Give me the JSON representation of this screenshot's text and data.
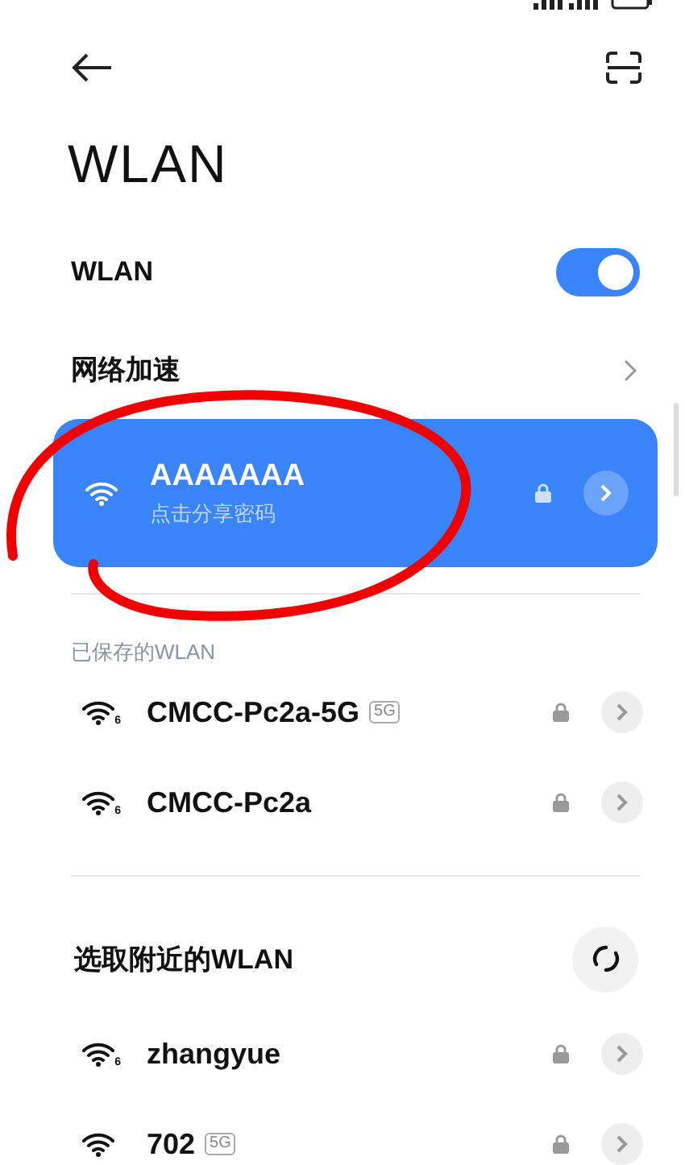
{
  "header": {
    "title": "WLAN"
  },
  "wlan_toggle": {
    "label": "WLAN",
    "on": true
  },
  "network_boost": {
    "label": "网络加速"
  },
  "connected": {
    "name": "AAAAAAA",
    "subtitle": "点击分享密码",
    "secured": true
  },
  "saved": {
    "heading": "已保存的WLAN",
    "networks": [
      {
        "name": "CMCC-Pc2a-5G",
        "band": "5G",
        "wifi_badge": "6",
        "secured": true
      },
      {
        "name": "CMCC-Pc2a",
        "wifi_badge": "6",
        "secured": true
      }
    ]
  },
  "nearby": {
    "heading": "选取附近的WLAN",
    "networks": [
      {
        "name": "zhangyue",
        "wifi_badge": "6",
        "secured": true
      },
      {
        "name": "702",
        "band": "5G",
        "secured": true
      }
    ]
  }
}
